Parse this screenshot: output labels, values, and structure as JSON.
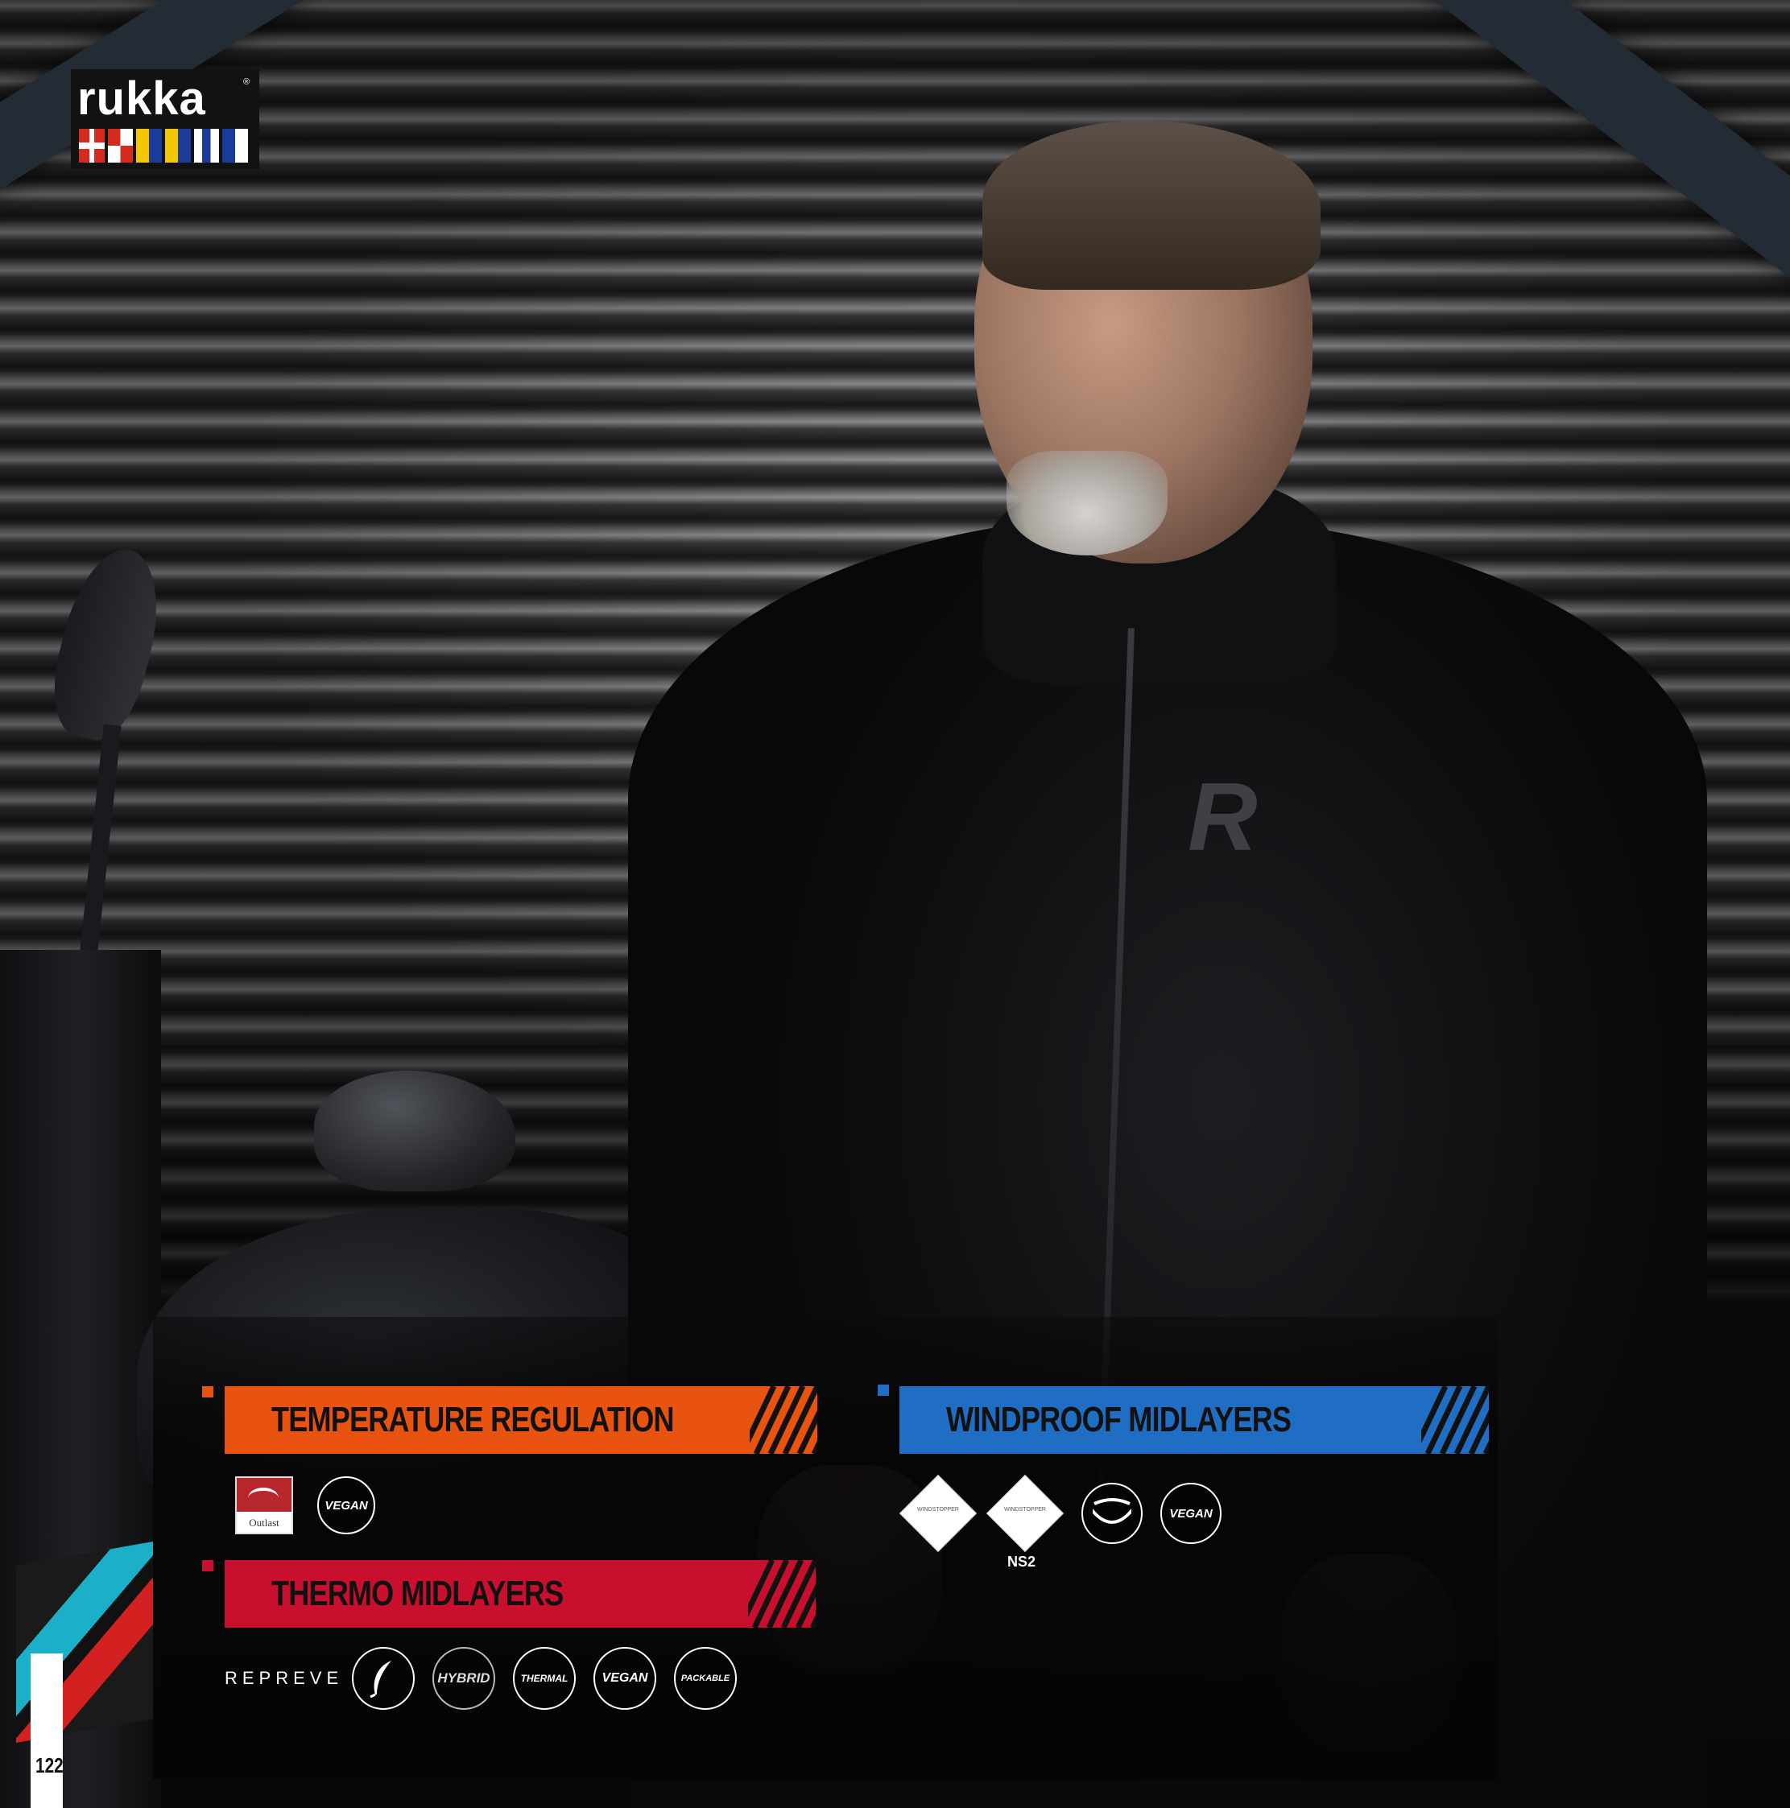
{
  "brand": {
    "name": "rukka",
    "registered": "®"
  },
  "page_number": "122",
  "colors": {
    "temperature_regulation": "#e8540f",
    "thermo_midlayers": "#c8102e",
    "windproof_midlayers": "#1f6ec4"
  },
  "sections": {
    "temperature_regulation": {
      "title": "TEMPERATURE REGULATION",
      "badges": [
        {
          "icon": "outlast-logo",
          "label": "Outlast"
        },
        {
          "icon": "vegan-badge",
          "label": "VEGAN"
        }
      ]
    },
    "thermo_midlayers": {
      "title": "THERMO MIDLAYERS",
      "badges": [
        {
          "icon": "repreve-logo",
          "label": "REPREVE"
        },
        {
          "icon": "feather-badge",
          "label": ""
        },
        {
          "icon": "hybrid-badge",
          "label": "HYBRID"
        },
        {
          "icon": "thermal-badge",
          "label": "THERMAL"
        },
        {
          "icon": "vegan-badge",
          "label": "VEGAN"
        },
        {
          "icon": "packable-badge",
          "label": "PACKABLE"
        }
      ]
    },
    "windproof_midlayers": {
      "title": "WINDPROOF MIDLAYERS",
      "badges": [
        {
          "icon": "windstopper-badge",
          "label": "WINDSTOPPER"
        },
        {
          "icon": "windstopper-ns2-badge",
          "label": "WINDSTOPPER",
          "caption": "NS2"
        },
        {
          "icon": "collar-badge",
          "label": ""
        },
        {
          "icon": "vegan-badge",
          "label": "VEGAN"
        }
      ]
    }
  }
}
